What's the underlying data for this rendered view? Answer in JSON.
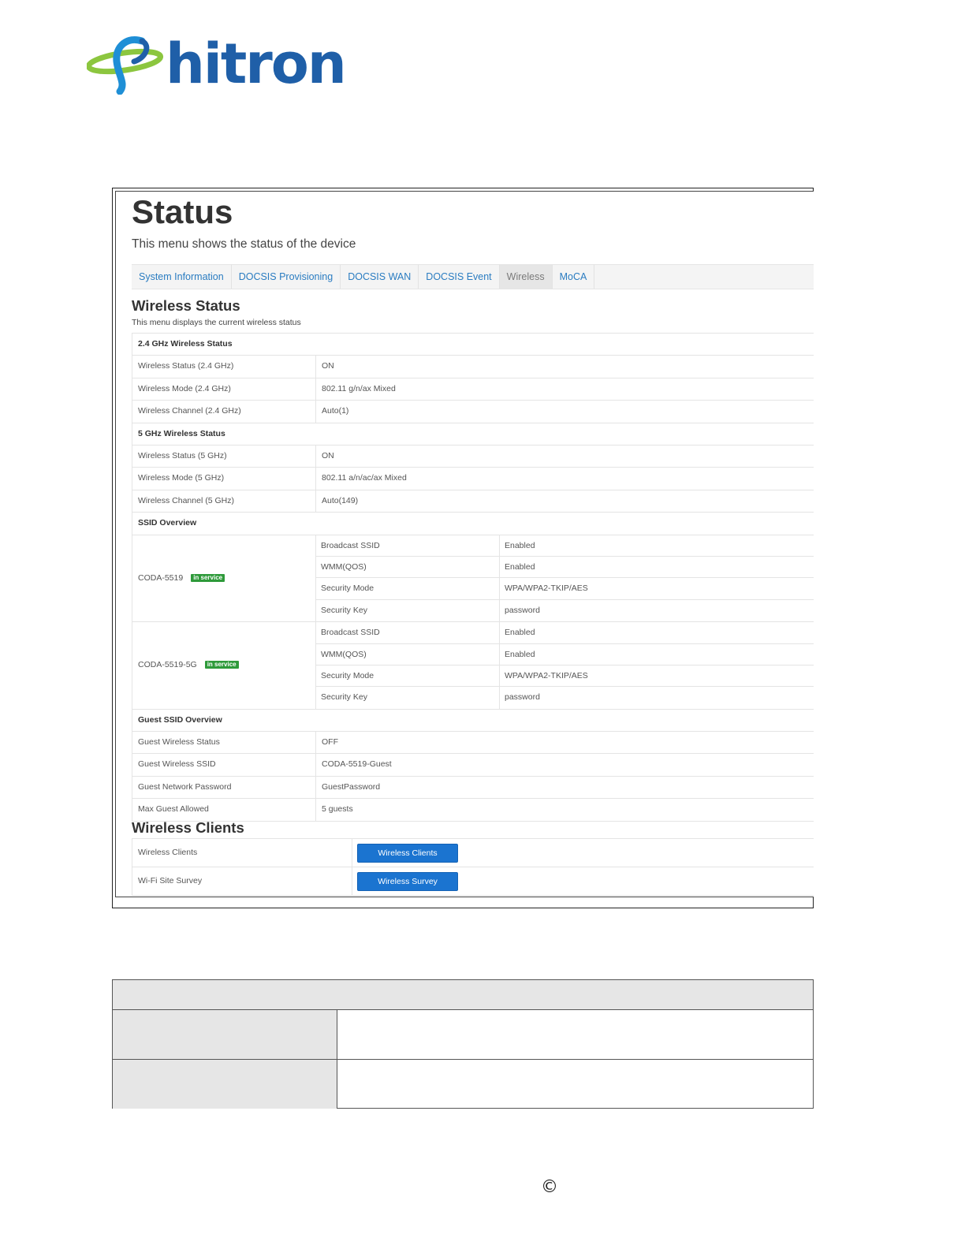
{
  "brand": {
    "logo_text": "hitron",
    "logo_color": "#1f5fa8",
    "swoosh_color": "#8cc63f"
  },
  "status_page": {
    "title": "Status",
    "description": "This menu shows the status of the device",
    "tabs": [
      {
        "label": "System Information",
        "active": false
      },
      {
        "label": "DOCSIS Provisioning",
        "active": false
      },
      {
        "label": "DOCSIS WAN",
        "active": false
      },
      {
        "label": "DOCSIS Event",
        "active": false
      },
      {
        "label": "Wireless",
        "active": true
      },
      {
        "label": "MoCA",
        "active": false
      }
    ]
  },
  "wireless_status": {
    "title": "Wireless Status",
    "description": "This menu displays the current wireless status",
    "band24": {
      "header": "2.4 GHz Wireless Status",
      "rows": [
        {
          "label": "Wireless Status (2.4 GHz)",
          "value": "ON"
        },
        {
          "label": "Wireless Mode (2.4 GHz)",
          "value": "802.11 g/n/ax Mixed"
        },
        {
          "label": "Wireless Channel (2.4 GHz)",
          "value": "Auto(1)"
        }
      ]
    },
    "band5": {
      "header": "5 GHz Wireless Status",
      "rows": [
        {
          "label": "Wireless Status (5 GHz)",
          "value": "ON"
        },
        {
          "label": "Wireless Mode (5 GHz)",
          "value": "802.11 a/n/ac/ax Mixed"
        },
        {
          "label": "Wireless Channel (5 GHz)",
          "value": "Auto(149)"
        }
      ]
    },
    "ssid_overview": {
      "header": "SSID Overview",
      "ssids": [
        {
          "name": "CODA-5519",
          "badge": "in service",
          "rows": [
            {
              "label": "Broadcast SSID",
              "value": "Enabled"
            },
            {
              "label": "WMM(QOS)",
              "value": "Enabled"
            },
            {
              "label": "Security Mode",
              "value": "WPA/WPA2-TKIP/AES"
            },
            {
              "label": "Security Key",
              "value": "password"
            }
          ]
        },
        {
          "name": "CODA-5519-5G",
          "badge": "in service",
          "rows": [
            {
              "label": "Broadcast SSID",
              "value": "Enabled"
            },
            {
              "label": "WMM(QOS)",
              "value": "Enabled"
            },
            {
              "label": "Security Mode",
              "value": "WPA/WPA2-TKIP/AES"
            },
            {
              "label": "Security Key",
              "value": "password"
            }
          ]
        }
      ]
    },
    "guest": {
      "header": "Guest SSID Overview",
      "rows": [
        {
          "label": "Guest Wireless Status",
          "value": "OFF"
        },
        {
          "label": "Guest Wireless SSID",
          "value": "CODA-5519-Guest"
        },
        {
          "label": "Guest Network Password",
          "value": "GuestPassword"
        },
        {
          "label": "Max Guest Allowed",
          "value": "5 guests"
        }
      ]
    }
  },
  "wireless_clients": {
    "title": "Wireless Clients",
    "rows": [
      {
        "label": "Wireless Clients",
        "button": "Wireless Clients"
      },
      {
        "label": "Wi-Fi Site Survey",
        "button": "Wireless Survey"
      }
    ]
  },
  "footer": {
    "copyright_symbol": "©"
  }
}
